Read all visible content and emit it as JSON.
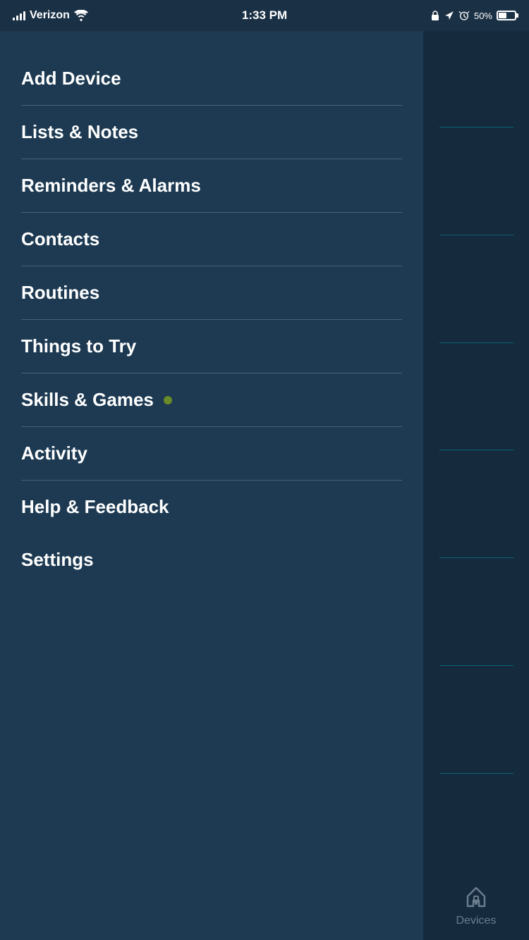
{
  "statusBar": {
    "carrier": "Verizon",
    "time": "1:33 PM",
    "battery_percent": "50%"
  },
  "menu": {
    "items": [
      {
        "id": "add-device",
        "label": "Add Device",
        "has_dot": false,
        "has_divider": true
      },
      {
        "id": "lists-notes",
        "label": "Lists & Notes",
        "has_dot": false,
        "has_divider": true
      },
      {
        "id": "reminders-alarms",
        "label": "Reminders & Alarms",
        "has_dot": false,
        "has_divider": true
      },
      {
        "id": "contacts",
        "label": "Contacts",
        "has_dot": false,
        "has_divider": true
      },
      {
        "id": "routines",
        "label": "Routines",
        "has_dot": false,
        "has_divider": true
      },
      {
        "id": "things-to-try",
        "label": "Things to Try",
        "has_dot": false,
        "has_divider": true
      },
      {
        "id": "skills-games",
        "label": "Skills & Games",
        "has_dot": true,
        "has_divider": true
      },
      {
        "id": "activity",
        "label": "Activity",
        "has_dot": false,
        "has_divider": true
      },
      {
        "id": "help-feedback",
        "label": "Help & Feedback",
        "has_dot": false,
        "has_divider": false
      },
      {
        "id": "settings",
        "label": "Settings",
        "has_dot": false,
        "has_divider": false
      }
    ]
  },
  "bottomTab": {
    "label": "Devices"
  }
}
